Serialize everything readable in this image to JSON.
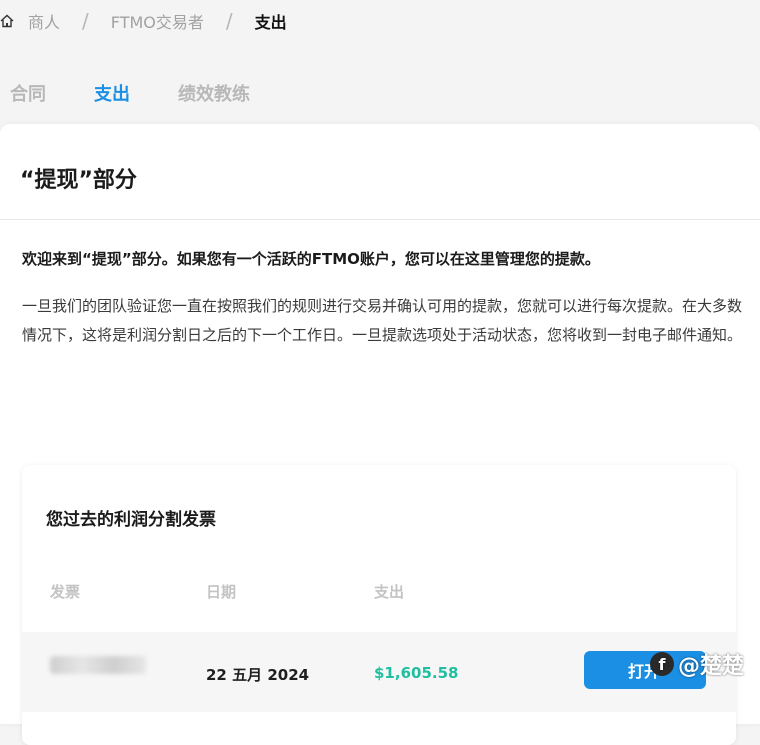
{
  "breadcrumb": {
    "home_icon": "home-icon",
    "items": [
      "商人",
      "FTMO交易者"
    ],
    "current": "支出",
    "separator": "/"
  },
  "tabs": [
    {
      "label": "合同",
      "active": false
    },
    {
      "label": "支出",
      "active": true
    },
    {
      "label": "绩效教练",
      "active": false
    }
  ],
  "section": {
    "title": "“提现”部分",
    "intro_bold": "欢迎来到“提现”部分。如果您有一个活跃的FTMO账户，您可以在这里管理您的提款。",
    "intro_text": "一旦我们的团队验证您一直在按照我们的规则进行交易并确认可用的提款，您就可以进行每次提款。在大多数情况下，这将是利润分割日之后的下一个工作日。一旦提款选项处于活动状态，您将收到一封电子邮件通知。"
  },
  "invoices": {
    "title": "您过去的利润分割发票",
    "columns": [
      "发票",
      "日期",
      "支出"
    ],
    "rows": [
      {
        "invoice": "",
        "date": "22 五月 2024",
        "amount": "$1,605.58",
        "action_label": "打开"
      }
    ]
  },
  "colors": {
    "accent": "#1a8fe3",
    "amount": "#1fbf9f"
  },
  "watermark": {
    "logo_letter": "f",
    "text": "@楚楚"
  }
}
